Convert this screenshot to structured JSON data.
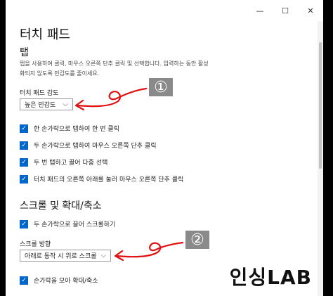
{
  "page": {
    "title": "터치 패드",
    "tap_section": "탭",
    "description": "탭을 사용하여 클릭, 마우스 오른쪽 단추 클릭 및 선택합니다. 입력하는 동안 활성화되지 않도록 민감도를 줄이세요."
  },
  "sensitivity": {
    "label": "터치 패드 감도",
    "value": "높은 민감도"
  },
  "tap_options": [
    {
      "label": "한 손가락으로 탭하여 한 번 클릭",
      "checked": true
    },
    {
      "label": "두 손가락으로 탭하여 마우스 오른쪽 단추 클릭",
      "checked": true
    },
    {
      "label": "두 번 탭하고 끌어 다중 선택",
      "checked": true
    },
    {
      "label": "터치 패드의 오른쪽 아래를 눌러 마우스 오른쪽 단추 클릭",
      "checked": true
    }
  ],
  "scroll_section": {
    "title": "스크롤 및 확대/축소",
    "two_finger_scroll": "두 손가락으로 끌어 스크롤하기",
    "direction_label": "스크롤 방향",
    "direction_value": "아래로 동작 시 위로 스크롤",
    "pinch_zoom": "손가락을 모아 확대/축소"
  },
  "window_controls": {
    "minimize": "—",
    "maximize": "☐",
    "close": "✕"
  },
  "annotations": {
    "marker_1": "①",
    "marker_2": "②",
    "arrow_color": "#e11010",
    "marker_bg": "#8a8a8a"
  },
  "watermark": "인싱LAB",
  "colors": {
    "checkbox": "#0066cc",
    "background": "#ffffff"
  }
}
